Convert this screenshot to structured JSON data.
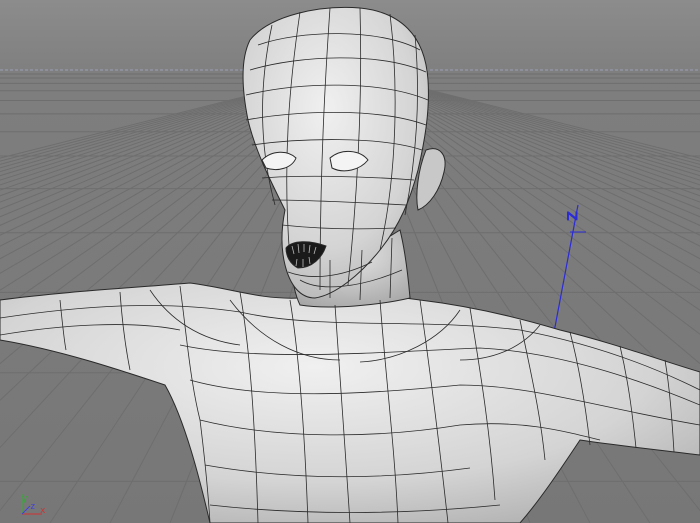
{
  "viewport": {
    "background_top": "#8a8a8a",
    "background_bottom": "#7a7a7a",
    "grid_color": "#6c6c6c",
    "mesh_fill": "#d9d9d9",
    "wire_color": "#2a2a2a",
    "horizon_color": "#9aa0b5",
    "z_axis_color": "#2b2bd8"
  },
  "z_axis_label": "Z",
  "gizmo": {
    "x": "x",
    "y": "y",
    "z": "z"
  }
}
